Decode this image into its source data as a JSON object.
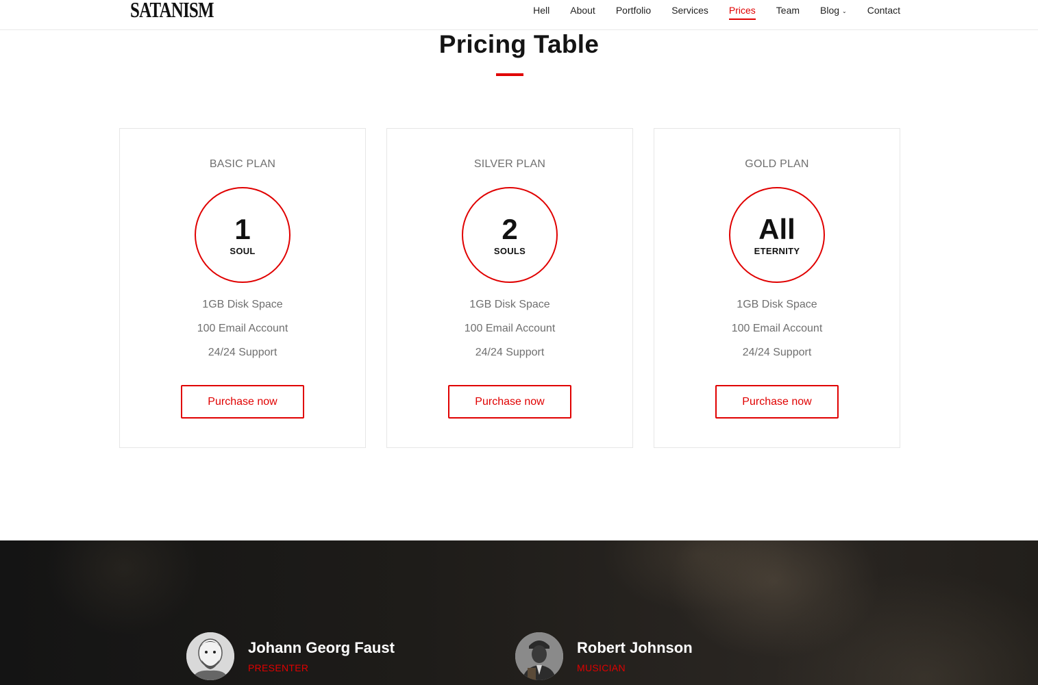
{
  "header": {
    "logo": "SATANISM",
    "nav": [
      {
        "label": "Hell"
      },
      {
        "label": "About"
      },
      {
        "label": "Portfolio"
      },
      {
        "label": "Services"
      },
      {
        "label": "Prices",
        "active": true
      },
      {
        "label": "Team"
      },
      {
        "label": "Blog",
        "has_dropdown": true
      },
      {
        "label": "Contact"
      }
    ],
    "accent_color": "#e00000"
  },
  "pricing": {
    "title": "Pricing Table",
    "plans": [
      {
        "name": "BASIC PLAN",
        "price_value": "1",
        "price_unit": "SOUL",
        "features": [
          "1GB Disk Space",
          "100 Email Account",
          "24/24 Support"
        ],
        "button": "Purchase now"
      },
      {
        "name": "SILVER PLAN",
        "price_value": "2",
        "price_unit": "SOULS",
        "features": [
          "1GB Disk Space",
          "100 Email Account",
          "24/24 Support"
        ],
        "button": "Purchase now"
      },
      {
        "name": "GOLD PLAN",
        "price_value": "All",
        "price_unit": "ETERNITY",
        "features": [
          "1GB Disk Space",
          "100 Email Account",
          "24/24 Support"
        ],
        "button": "Purchase now"
      }
    ]
  },
  "team": {
    "members": [
      {
        "name": "Johann Georg Faust",
        "role": "PRESENTER"
      },
      {
        "name": "Robert Johnson",
        "role": "MUSICIAN"
      }
    ]
  }
}
